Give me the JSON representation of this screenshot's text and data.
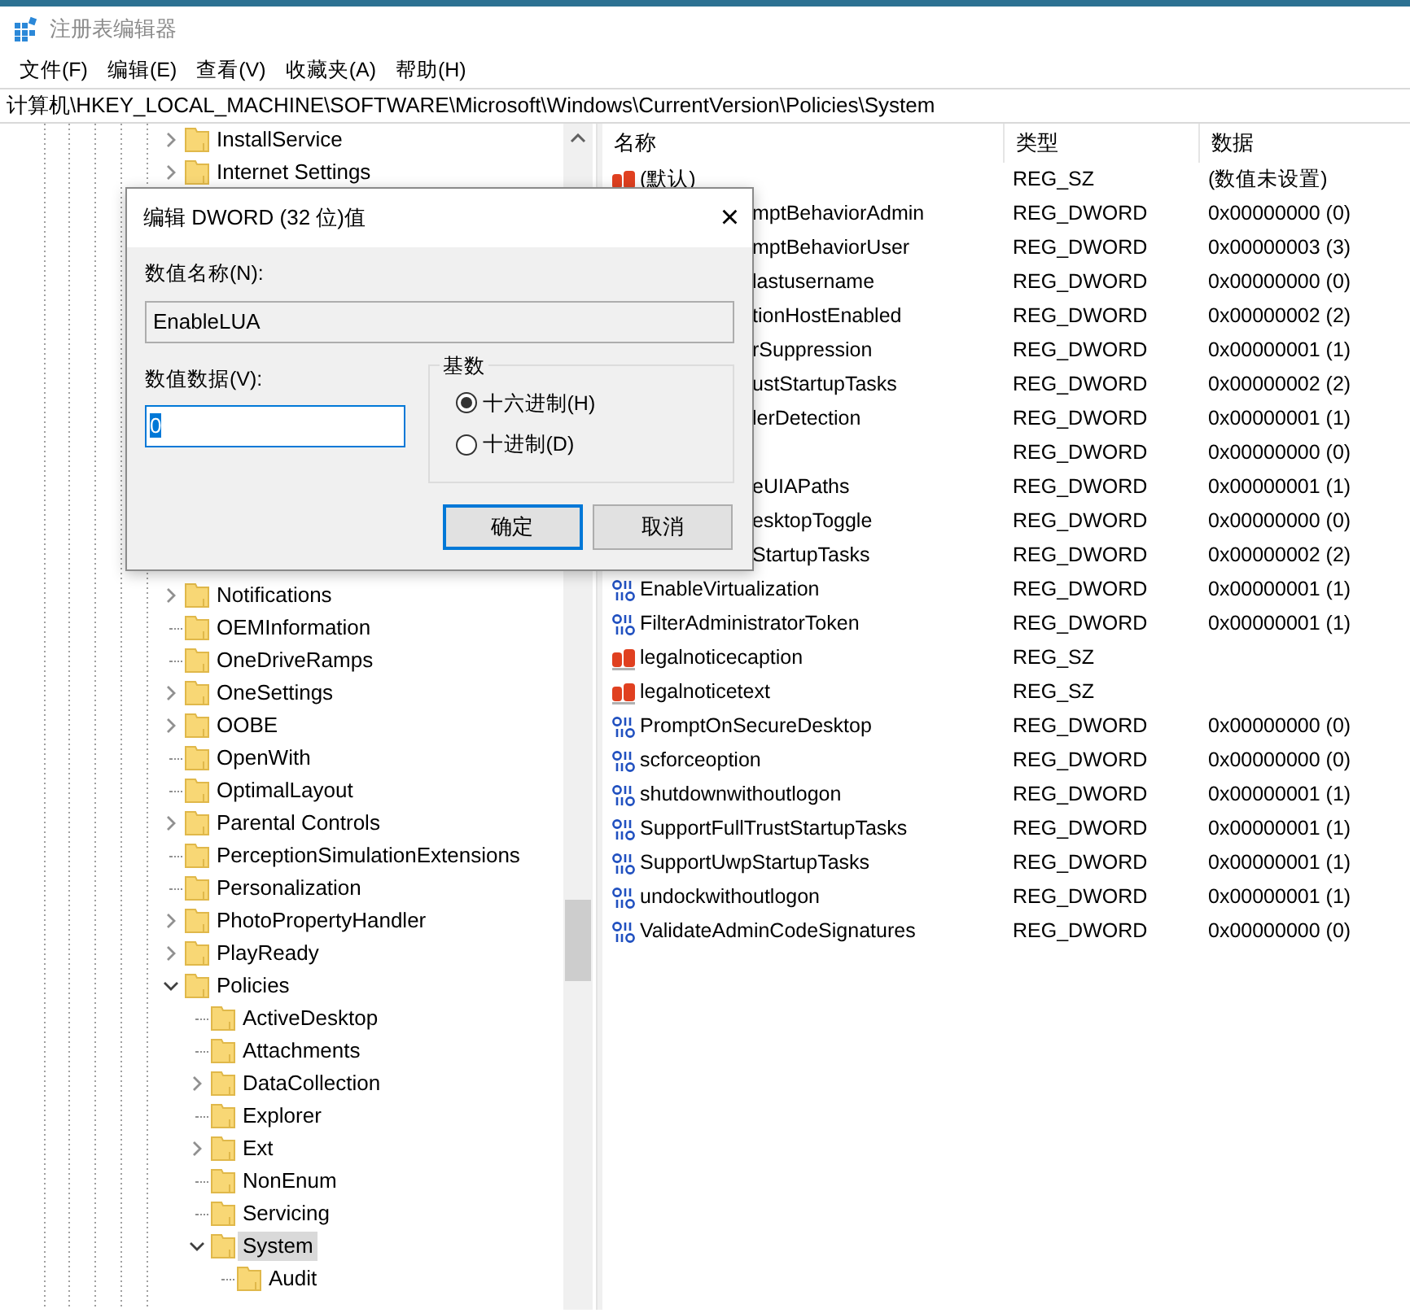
{
  "window": {
    "title": "注册表编辑器"
  },
  "menu": [
    "文件(F)",
    "编辑(E)",
    "查看(V)",
    "收藏夹(A)",
    "帮助(H)"
  ],
  "address": "计算机\\HKEY_LOCAL_MACHINE\\SOFTWARE\\Microsoft\\Windows\\CurrentVersion\\Policies\\System",
  "tree": [
    {
      "label": "InstallService",
      "kind": "branch",
      "expanded": false,
      "selected": false
    },
    {
      "label": "Internet Settings",
      "kind": "branch",
      "expanded": false,
      "selected": false
    },
    {
      "label": "Notifications",
      "kind": "branch",
      "expanded": false,
      "selected": false,
      "after_gap": true
    },
    {
      "label": "OEMInformation",
      "kind": "leaf",
      "selected": false
    },
    {
      "label": "OneDriveRamps",
      "kind": "leaf",
      "selected": false
    },
    {
      "label": "OneSettings",
      "kind": "branch",
      "expanded": false,
      "selected": false
    },
    {
      "label": "OOBE",
      "kind": "branch",
      "expanded": false,
      "selected": false
    },
    {
      "label": "OpenWith",
      "kind": "leaf",
      "selected": false
    },
    {
      "label": "OptimalLayout",
      "kind": "leaf",
      "selected": false
    },
    {
      "label": "Parental Controls",
      "kind": "branch",
      "expanded": false,
      "selected": false
    },
    {
      "label": "PerceptionSimulationExtensions",
      "kind": "leaf",
      "selected": false
    },
    {
      "label": "Personalization",
      "kind": "leaf",
      "selected": false
    },
    {
      "label": "PhotoPropertyHandler",
      "kind": "branch",
      "expanded": false,
      "selected": false
    },
    {
      "label": "PlayReady",
      "kind": "branch",
      "expanded": false,
      "selected": false
    },
    {
      "label": "Policies",
      "kind": "branch",
      "expanded": true,
      "selected": false,
      "children": [
        {
          "label": "ActiveDesktop",
          "kind": "leaf",
          "selected": false
        },
        {
          "label": "Attachments",
          "kind": "leaf",
          "selected": false
        },
        {
          "label": "DataCollection",
          "kind": "branch",
          "expanded": false,
          "selected": false
        },
        {
          "label": "Explorer",
          "kind": "leaf",
          "selected": false
        },
        {
          "label": "Ext",
          "kind": "branch",
          "expanded": false,
          "selected": false
        },
        {
          "label": "NonEnum",
          "kind": "leaf",
          "selected": false
        },
        {
          "label": "Servicing",
          "kind": "leaf",
          "selected": false
        },
        {
          "label": "System",
          "kind": "branch",
          "expanded": true,
          "selected": true,
          "children": [
            {
              "label": "Audit",
              "kind": "leaf",
              "selected": false
            }
          ]
        }
      ]
    }
  ],
  "values": {
    "columns": [
      "名称",
      "类型",
      "数据"
    ],
    "rows": [
      {
        "kind": "string",
        "name": "(默认)",
        "type": "REG_SZ",
        "data": "(数值未设置)"
      },
      {
        "name": "mptBehaviorAdmin",
        "type": "REG_DWORD",
        "data": "0x00000000 (0)",
        "partly_hidden": true
      },
      {
        "name": "mptBehaviorUser",
        "type": "REG_DWORD",
        "data": "0x00000003 (3)",
        "partly_hidden": true
      },
      {
        "name": "lastusername",
        "type": "REG_DWORD",
        "data": "0x00000000 (0)",
        "partly_hidden": true
      },
      {
        "name": "tionHostEnabled",
        "type": "REG_DWORD",
        "data": "0x00000002 (2)",
        "partly_hidden": true
      },
      {
        "name": "rSuppression",
        "type": "REG_DWORD",
        "data": "0x00000001 (1)",
        "partly_hidden": true
      },
      {
        "name": "ustStartupTasks",
        "type": "REG_DWORD",
        "data": "0x00000002 (2)",
        "partly_hidden": true
      },
      {
        "name": "lerDetection",
        "type": "REG_DWORD",
        "data": "0x00000001 (1)",
        "partly_hidden": true
      },
      {
        "type": "REG_DWORD",
        "data": "0x00000000 (0)"
      },
      {
        "name": "eUIAPaths",
        "type": "REG_DWORD",
        "data": "0x00000001 (1)",
        "partly_hidden": true
      },
      {
        "name": "esktopToggle",
        "type": "REG_DWORD",
        "data": "0x00000000 (0)",
        "partly_hidden": true
      },
      {
        "name": "StartupTasks",
        "type": "REG_DWORD",
        "data": "0x00000002 (2)",
        "partly_hidden": true
      },
      {
        "kind": "dword",
        "name": "EnableVirtualization",
        "type": "REG_DWORD",
        "data": "0x00000001 (1)"
      },
      {
        "kind": "dword",
        "name": "FilterAdministratorToken",
        "type": "REG_DWORD",
        "data": "0x00000001 (1)"
      },
      {
        "kind": "string",
        "name": "legalnoticecaption",
        "type": "REG_SZ"
      },
      {
        "kind": "string",
        "name": "legalnoticetext",
        "type": "REG_SZ"
      },
      {
        "kind": "dword",
        "name": "PromptOnSecureDesktop",
        "type": "REG_DWORD",
        "data": "0x00000000 (0)"
      },
      {
        "kind": "dword",
        "name": "scforceoption",
        "type": "REG_DWORD",
        "data": "0x00000000 (0)"
      },
      {
        "kind": "dword",
        "name": "shutdownwithoutlogon",
        "type": "REG_DWORD",
        "data": "0x00000001 (1)"
      },
      {
        "kind": "dword",
        "name": "SupportFullTrustStartupTasks",
        "type": "REG_DWORD",
        "data": "0x00000001 (1)"
      },
      {
        "kind": "dword",
        "name": "SupportUwpStartupTasks",
        "type": "REG_DWORD",
        "data": "0x00000001 (1)"
      },
      {
        "kind": "dword",
        "name": "undockwithoutlogon",
        "type": "REG_DWORD",
        "data": "0x00000001 (1)"
      },
      {
        "kind": "dword",
        "name": "ValidateAdminCodeSignatures",
        "type": "REG_DWORD",
        "data": "0x00000000 (0)"
      }
    ]
  },
  "dialog": {
    "title": "编辑 DWORD (32 位)值",
    "close": "×",
    "name_label": "数值名称(N):",
    "name_value": "EnableLUA",
    "name_read_only": true,
    "data_label": "数值数据(V):",
    "data_value": "0",
    "data_value_selected": true,
    "base_title": "基数",
    "base_options": [
      {
        "label": "十六进制(H)",
        "selected": true
      },
      {
        "label": "十进制(D)",
        "selected": false
      }
    ],
    "buttons": [
      {
        "label": "确定",
        "default": true
      },
      {
        "label": "取消",
        "default": false
      }
    ]
  }
}
